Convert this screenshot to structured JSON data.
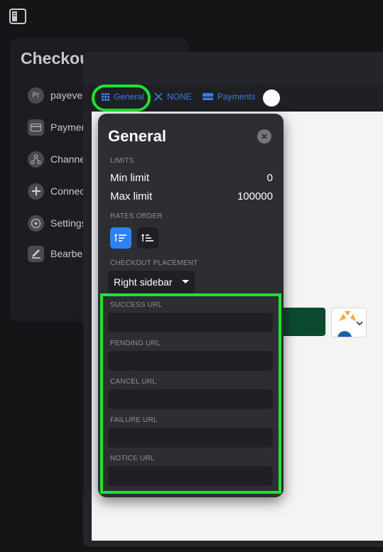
{
  "topbar": {
    "icon": "sidebar-toggle-icon"
  },
  "sidebar": {
    "title": "Checkout",
    "items": [
      {
        "label": "payever",
        "icon_text": "Pr",
        "icon": "avatar"
      },
      {
        "label": "Payment",
        "icon": "card-icon"
      },
      {
        "label": "Channels",
        "icon": "channels-icon"
      },
      {
        "label": "Connect",
        "icon": "plus-icon"
      },
      {
        "label": "Settings",
        "icon": "settings-icon"
      },
      {
        "label": "Bearbeiten",
        "icon": "edit-icon"
      }
    ]
  },
  "tabs": {
    "general": "General",
    "none": "NONE",
    "payments": "Payments"
  },
  "panel": {
    "title": "General",
    "limits_label": "LIMITS",
    "min_label": "Min limit",
    "min_value": "0",
    "max_label": "Max limit",
    "max_value": "100000",
    "rates_label": "RATES ORDER",
    "placement_label": "CHECKOUT PLACEMENT",
    "placement_value": "Right sidebar",
    "urls": [
      {
        "label": "SUCCESS URL",
        "value": ""
      },
      {
        "label": "PENDING URL",
        "value": ""
      },
      {
        "label": "CANCEL URL",
        "value": ""
      },
      {
        "label": "FAILURE URL",
        "value": ""
      },
      {
        "label": "NOTICE URL",
        "value": ""
      }
    ]
  },
  "colors": {
    "accent": "#2f82f5",
    "highlight": "#1ee32f",
    "panel_bg": "#2d2e33",
    "tab_text": "#3a7be0"
  }
}
